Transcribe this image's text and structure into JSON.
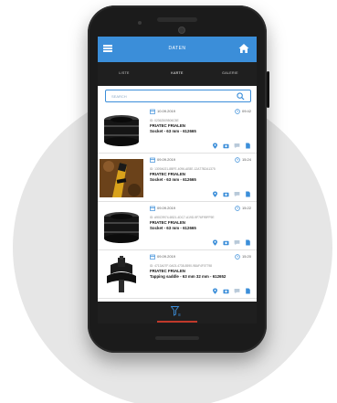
{
  "app": {
    "title": "DATEN",
    "accent_color": "#3b8ed9",
    "dark_color": "#1f1f1f"
  },
  "tabs": [
    {
      "label": "LISTE",
      "active": false
    },
    {
      "label": "KARTE",
      "active": true
    },
    {
      "label": "GALERIE",
      "active": false
    }
  ],
  "search": {
    "placeholder": "SEARCH"
  },
  "items": [
    {
      "date": "10.09.2019",
      "time": "09:42",
      "serial": "ID: 02362509506C5E",
      "maker": "FRIATEC FRIALEN",
      "product": "Socket - 63 mm - 612665",
      "thumb": "black-socket"
    },
    {
      "date": "09.09.2019",
      "time": "15:24",
      "serial": "ID: 1309A021-8BFE-4096-AE8E-12A77B2A1375",
      "maker": "FRIATEC FRIALEN",
      "product": "Socket - 63 mm - 612665",
      "thumb": "pipe-yellow"
    },
    {
      "date": "09.09.2019",
      "time": "15:22",
      "serial": "ID: A90C9974-6B21-4DC7-A19D-9F76F99FF9E",
      "maker": "FRIATEC FRIALEN",
      "product": "Socket - 63 mm - 612665",
      "thumb": "black-socket"
    },
    {
      "date": "09.09.2019",
      "time": "15:20",
      "serial": "ID: 4713A07F-0A03-4738-8590-98AF4F07798",
      "maker": "FRIATEC FRIALEN",
      "product": "Tapping saddle - 63 mm 32 mm - 612652",
      "thumb": "saddle"
    }
  ],
  "icons": {
    "menu": "hamburger-icon",
    "home": "home-icon",
    "search": "search-icon",
    "calendar": "calendar-icon",
    "clock": "clock-icon",
    "location": "location-pin-icon",
    "camera": "camera-icon",
    "comment": "comment-icon",
    "document": "document-icon",
    "filter": "filter-icon"
  }
}
